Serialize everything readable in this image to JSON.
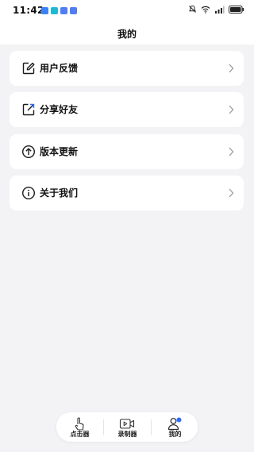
{
  "status_bar": {
    "time": "11:42",
    "notification_colors": [
      "#3b82f6",
      "#22b8cf",
      "#4f7df3",
      "#4f7df3"
    ],
    "icons": [
      "mute-icon",
      "wifi-icon",
      "cellular-signal-icon",
      "battery-icon"
    ]
  },
  "header": {
    "title": "我的"
  },
  "menu": [
    {
      "label": "用户反馈",
      "icon": "edit-icon"
    },
    {
      "label": "分享好友",
      "icon": "share-icon"
    },
    {
      "label": "版本更新",
      "icon": "update-arrow-icon"
    },
    {
      "label": "关于我们",
      "icon": "info-icon"
    }
  ],
  "tab_bar": {
    "items": [
      {
        "label": "点击器",
        "icon": "tap-hand-icon"
      },
      {
        "label": "录制器",
        "icon": "video-record-icon"
      },
      {
        "label": "我的",
        "icon": "profile-icon"
      }
    ],
    "active_index": 2,
    "accent_color": "#2f6bff"
  },
  "colors": {
    "background": "#f3f3f5",
    "card": "#ffffff",
    "text": "#111111",
    "chevron": "#9a9aa2"
  }
}
